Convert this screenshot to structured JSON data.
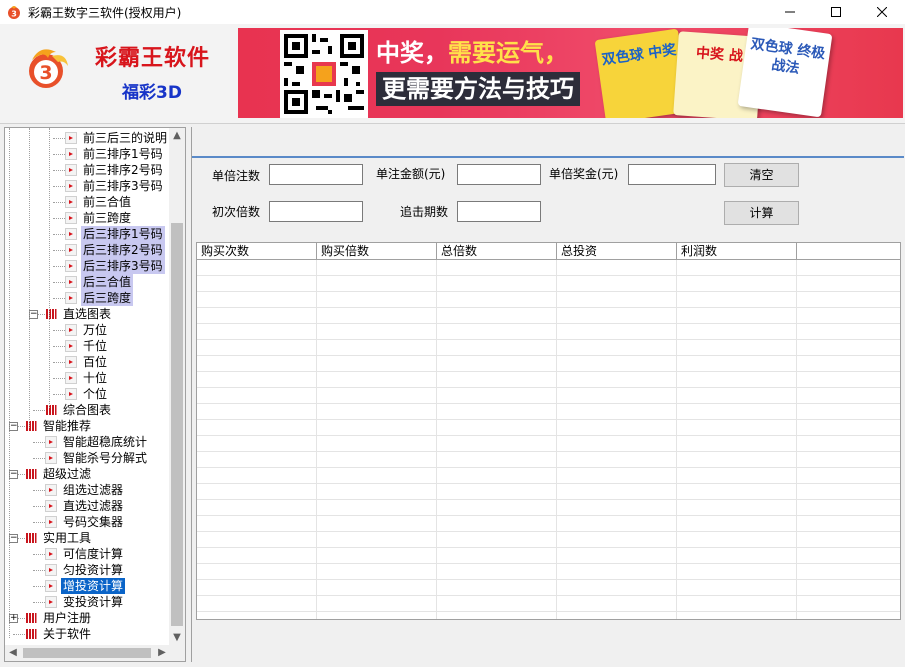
{
  "window": {
    "title": "彩霸王数字三软件(授权用户)"
  },
  "header": {
    "brand_name": "彩霸王软件",
    "product": "福彩3D",
    "banner_line1_a": "中奖，",
    "banner_line1_b": "需要运气，",
    "banner_line2": "更需要方法与技巧",
    "book1": "双色球 中奖",
    "book2": "中奖 战",
    "book3": "双色球 终极战法"
  },
  "tree": {
    "items": [
      {
        "label": "前三后三的说明",
        "level": 3,
        "state": "normal"
      },
      {
        "label": "前三排序1号码",
        "level": 3,
        "state": "normal"
      },
      {
        "label": "前三排序2号码",
        "level": 3,
        "state": "normal"
      },
      {
        "label": "前三排序3号码",
        "level": 3,
        "state": "normal"
      },
      {
        "label": "前三合值",
        "level": 3,
        "state": "normal"
      },
      {
        "label": "前三跨度",
        "level": 3,
        "state": "normal"
      },
      {
        "label": "后三排序1号码",
        "level": 3,
        "state": "selected"
      },
      {
        "label": "后三排序2号码",
        "level": 3,
        "state": "selected"
      },
      {
        "label": "后三排序3号码",
        "level": 3,
        "state": "selected"
      },
      {
        "label": "后三合值",
        "level": 3,
        "state": "selected"
      },
      {
        "label": "后三跨度",
        "level": 3,
        "state": "selected"
      },
      {
        "label": "直选图表",
        "level": 2,
        "state": "normal"
      },
      {
        "label": "万位",
        "level": 3,
        "state": "normal"
      },
      {
        "label": "千位",
        "level": 3,
        "state": "normal"
      },
      {
        "label": "百位",
        "level": 3,
        "state": "normal"
      },
      {
        "label": "十位",
        "level": 3,
        "state": "normal"
      },
      {
        "label": "个位",
        "level": 3,
        "state": "normal"
      },
      {
        "label": "综合图表",
        "level": 2,
        "state": "normal"
      },
      {
        "label": "智能推荐",
        "level": 1,
        "state": "normal"
      },
      {
        "label": "智能超稳底统计",
        "level": 2,
        "state": "normal"
      },
      {
        "label": "智能杀号分解式",
        "level": 2,
        "state": "normal"
      },
      {
        "label": "超级过滤",
        "level": 1,
        "state": "normal"
      },
      {
        "label": "组选过滤器",
        "level": 2,
        "state": "normal"
      },
      {
        "label": "直选过滤器",
        "level": 2,
        "state": "normal"
      },
      {
        "label": "号码交集器",
        "level": 2,
        "state": "normal"
      },
      {
        "label": "实用工具",
        "level": 1,
        "state": "normal"
      },
      {
        "label": "可信度计算",
        "level": 2,
        "state": "normal"
      },
      {
        "label": "匀投资计算",
        "level": 2,
        "state": "normal"
      },
      {
        "label": "增投资计算",
        "level": 2,
        "state": "focused"
      },
      {
        "label": "变投资计算",
        "level": 2,
        "state": "normal"
      },
      {
        "label": "用户注册",
        "level": 1,
        "state": "normal"
      },
      {
        "label": "关于软件",
        "level": 1,
        "state": "normal"
      }
    ]
  },
  "form": {
    "unit_bets_label": "单倍注数",
    "unit_bets_value": "",
    "bet_amount_label": "单注金额(元)",
    "bet_amount_value": "",
    "unit_prize_label": "单倍奖金(元)",
    "unit_prize_value": "",
    "initial_multiple_label": "初次倍数",
    "initial_multiple_value": "",
    "chase_periods_label": "追击期数",
    "chase_periods_value": "",
    "clear_label": "清空",
    "calc_label": "计算"
  },
  "grid": {
    "columns": [
      "购买次数",
      "购买倍数",
      "总倍数",
      "总投资",
      "利润数",
      ""
    ]
  },
  "colors": {
    "brand_red": "#d8151c",
    "brand_blue": "#1734c8",
    "selection": "#c8c8f0",
    "focus": "#0a64c8"
  }
}
